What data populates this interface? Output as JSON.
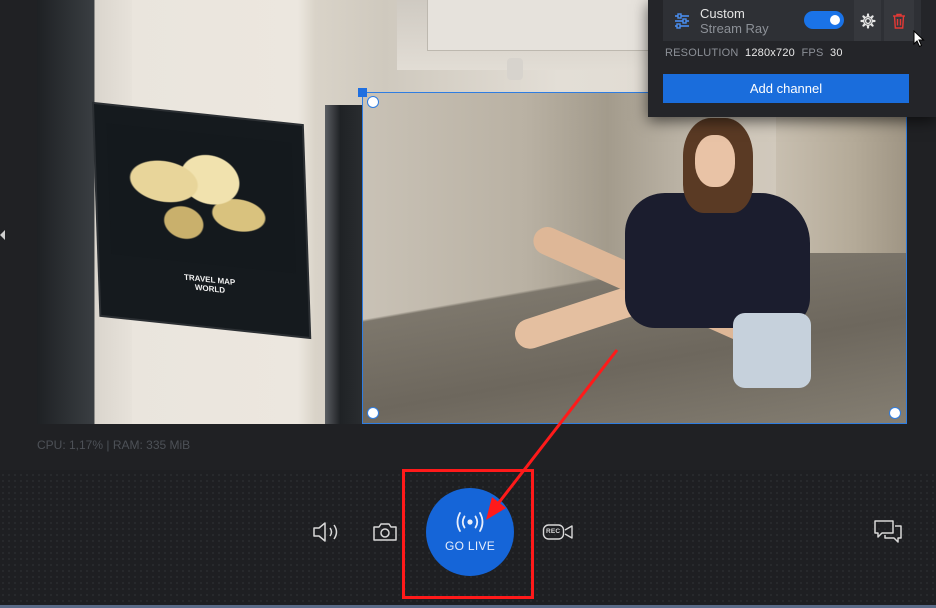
{
  "preview": {
    "poster_text": "TRAVEL MAP\nWORLD"
  },
  "stats": {
    "text": "CPU: 1,17% | RAM: 335 MiB"
  },
  "channel": {
    "name": "Custom",
    "service": "Stream Ray",
    "enabled": true,
    "resolution_label": "RESOLUTION",
    "resolution_value": "1280x720",
    "fps_label": "FPS",
    "fps_value": "30",
    "add_label": "Add channel"
  },
  "controls": {
    "audio_icon": "speaker-icon",
    "snapshot_icon": "camera-icon",
    "go_live_label": "GO LIVE",
    "record_label": "REC",
    "chat_icon": "chat-icon"
  },
  "colors": {
    "accent": "#1a6ddc",
    "go_live": "#1565d8",
    "annotation": "#ff1a1a",
    "background": "#1e1f22",
    "delete": "#e53935"
  }
}
